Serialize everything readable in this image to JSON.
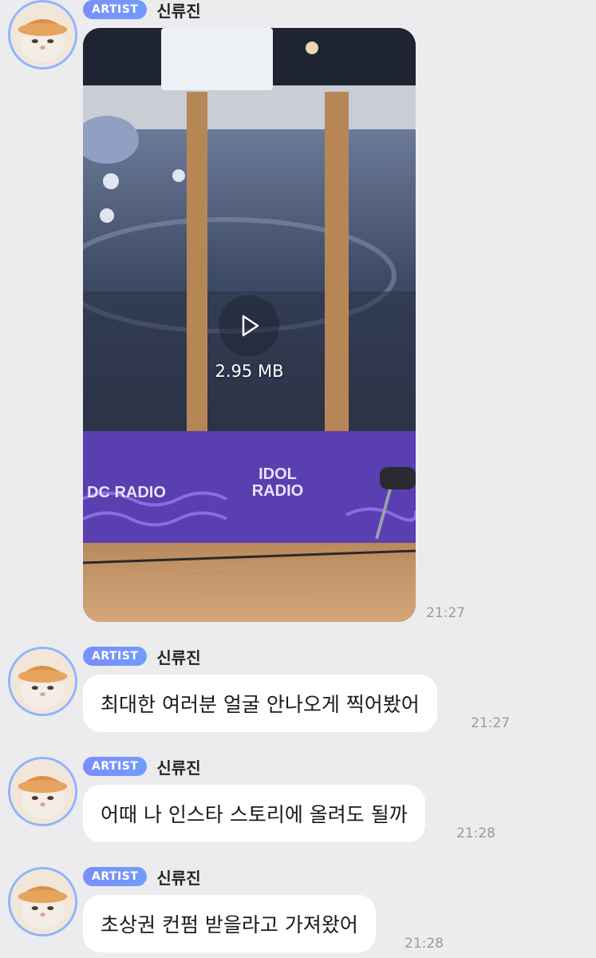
{
  "messages": [
    {
      "badge": "ARTIST",
      "sender": "신류진",
      "type": "video",
      "video_size": "2.95 MB",
      "time": "21:27"
    },
    {
      "badge": "ARTIST",
      "sender": "신류진",
      "type": "text",
      "text": "최대한 여러분 얼굴 안나오게 찍어봤어",
      "time": "21:27"
    },
    {
      "badge": "ARTIST",
      "sender": "신류진",
      "type": "text",
      "text": "어때 나 인스타 스토리에 올려도 될까",
      "time": "21:28"
    },
    {
      "badge": "ARTIST",
      "sender": "신류진",
      "type": "text",
      "text": "초상권 컨펌 받을라고 가져왔어",
      "time": "21:28"
    }
  ],
  "video_sign_text": {
    "left": "DC RADIO",
    "center_line1": "IDOL",
    "center_line2": "RADIO"
  },
  "colors": {
    "background": "#ececee",
    "badge": "#7c8dfb",
    "avatar_ring": "#8fb4ff",
    "time": "#9a9a9f"
  },
  "icons": {
    "avatar": "kitten-avatar-icon",
    "play": "play-icon"
  }
}
